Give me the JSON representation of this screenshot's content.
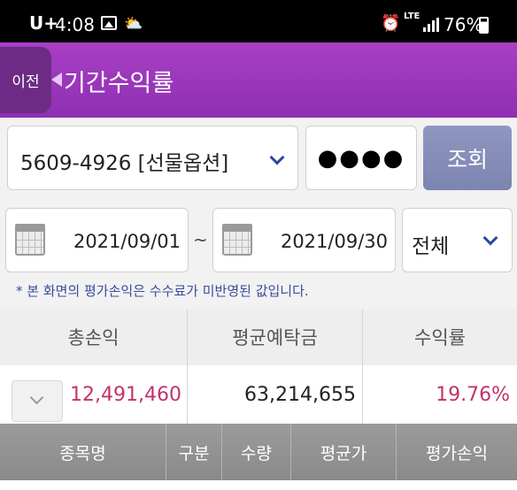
{
  "status_bar": {
    "carrier": "U+",
    "time": "4:08",
    "network": "LTE",
    "battery": "76%"
  },
  "header": {
    "back_label": "이전",
    "title": "기간수익률"
  },
  "account": {
    "selected": "5609-4926 [선물옵션]",
    "password_mask": "●●●●",
    "search_label": "조회"
  },
  "period": {
    "start_date": "2021/09/01",
    "separator": "~",
    "end_date": "2021/09/30",
    "filter": "전체",
    "notice": "* 본 화면의 평가손익은 수수료가 미반영된 값입니다."
  },
  "summary": {
    "headers": [
      "총손익",
      "평균예탁금",
      "수익률"
    ],
    "total_profit": "12,491,460",
    "avg_deposit": "63,214,655",
    "return_rate": "19.76%"
  },
  "detail_columns": [
    "종목명",
    "구분",
    "수량",
    "평균가",
    "평가손익"
  ],
  "colors": {
    "header_purple": "#9a37bb",
    "positive_red": "#c3336a",
    "button_blue": "#8088b6",
    "link_blue": "#3a4d9a"
  }
}
